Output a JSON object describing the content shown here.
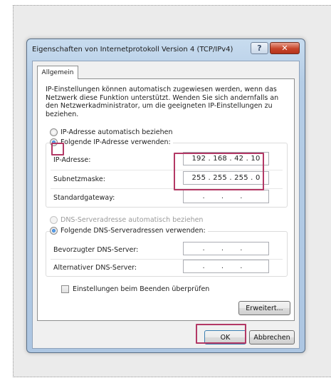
{
  "dialog": {
    "title": "Eigenschaften von Internetprotokoll Version 4 (TCP/IPv4)",
    "help_label": "?",
    "close_label": "✕"
  },
  "tabs": [
    {
      "label": "Allgemein"
    }
  ],
  "description": "IP-Einstellungen können automatisch zugewiesen werden, wenn das Netzwerk diese Funktion unterstützt. Wenden Sie sich andernfalls an den Netzwerkadministrator, um die geeigneten IP-Einstellungen zu beziehen.",
  "ip_mode": {
    "auto_label": "IP-Adresse automatisch beziehen",
    "manual_label": "Folgende IP-Adresse verwenden:",
    "selected": "manual"
  },
  "ip_fields": {
    "ip_label": "IP-Adresse:",
    "ip_value": "192 . 168 . 42 . 10",
    "subnet_label": "Subnetzmaske:",
    "subnet_value": "255 . 255 . 255 . 0",
    "gateway_label": "Standardgateway:",
    "gateway_value": ". . ."
  },
  "dns_mode": {
    "auto_label": "DNS-Serveradresse automatisch beziehen",
    "manual_label": "Folgende DNS-Serveradressen verwenden:",
    "selected": "manual"
  },
  "dns_fields": {
    "preferred_label": "Bevorzugter DNS-Server:",
    "preferred_value": ". . .",
    "alternate_label": "Alternativer DNS-Server:",
    "alternate_value": ". . ."
  },
  "validate_checkbox": {
    "label": "Einstellungen beim Beenden überprüfen",
    "checked": false
  },
  "buttons": {
    "advanced": "Erweitert...",
    "ok": "OK",
    "cancel": "Abbrechen"
  },
  "colors": {
    "highlight": "#b33865",
    "title_bar": "#b5cde6",
    "close_button": "#c7452a"
  }
}
